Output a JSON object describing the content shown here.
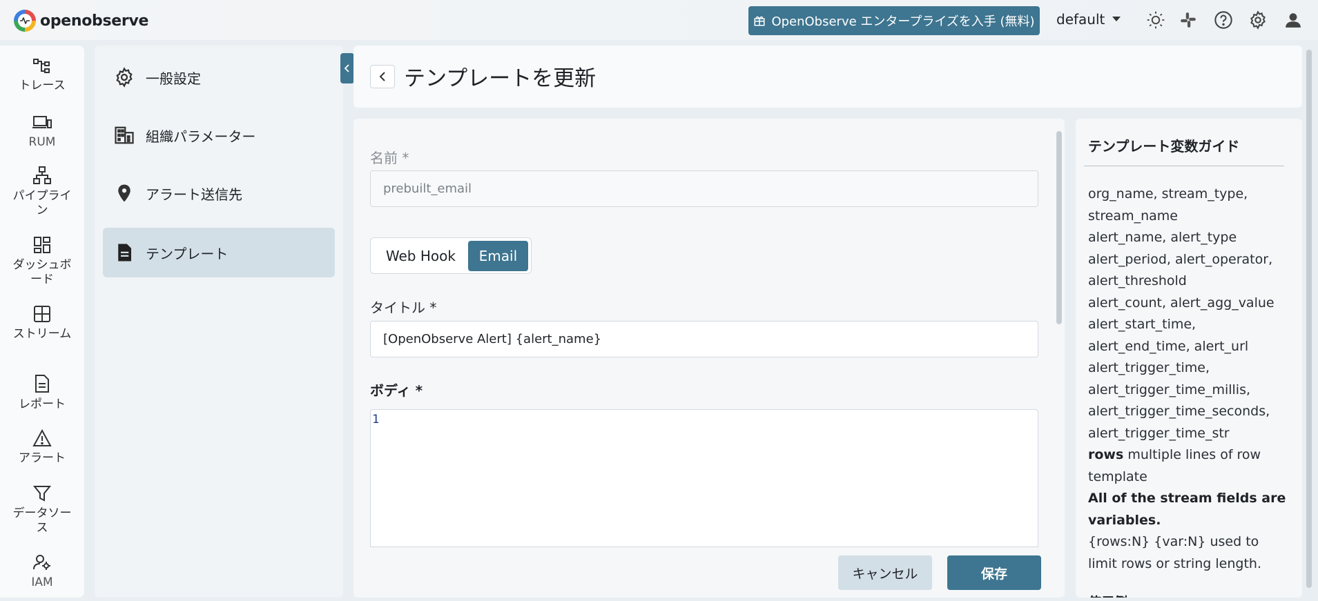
{
  "topbar": {
    "logo_text": "openobserve",
    "enterprise_label": "OpenObserve エンタープライズを入手 (無料)",
    "org_value": "default",
    "icons": [
      "theme-icon",
      "slack-icon",
      "help-icon",
      "settings-icon",
      "user-icon"
    ]
  },
  "leftnav": {
    "items": [
      {
        "label": "トレース",
        "icon": "traces-icon"
      },
      {
        "label": "RUM",
        "icon": "rum-icon"
      },
      {
        "label": "パイプライン",
        "icon": "pipeline-icon"
      },
      {
        "label": "ダッシュボード",
        "icon": "dashboard-icon"
      },
      {
        "label": "ストリーム",
        "icon": "streams-icon"
      },
      {
        "label": "レポート",
        "icon": "reports-icon"
      },
      {
        "label": "アラート",
        "icon": "alerts-icon"
      },
      {
        "label": "データソース",
        "icon": "datasources-icon"
      },
      {
        "label": "IAM",
        "icon": "iam-icon"
      }
    ]
  },
  "subnav": {
    "items": [
      {
        "label": "一般設定",
        "icon": "gear-icon"
      },
      {
        "label": "組織パラメーター",
        "icon": "building-icon"
      },
      {
        "label": "アラート送信先",
        "icon": "location-pin-icon"
      },
      {
        "label": "テンプレート",
        "icon": "document-icon",
        "active": true
      }
    ]
  },
  "header": {
    "title": "テンプレートを更新"
  },
  "form": {
    "name_label": "名前 *",
    "name_value": "prebuilt_email",
    "type_options": [
      "Web Hook",
      "Email"
    ],
    "type_selected": "Email",
    "title_label": "タイトル *",
    "title_value": "[OpenObserve Alert] {alert_name}",
    "body_label": "ボディ *",
    "body_line_number": "1",
    "cancel_label": "キャンセル",
    "save_label": "保存"
  },
  "guide": {
    "title": "テンプレート変数ガイド",
    "vars_1": "org_name, stream_type, stream_name",
    "vars_2": "alert_name, alert_type",
    "vars_3": "alert_period, alert_operator, alert_threshold",
    "vars_4": "alert_count, alert_agg_value",
    "vars_5": "alert_start_time, alert_end_time, alert_url",
    "vars_6": "alert_trigger_time, alert_trigger_time_millis, alert_trigger_time_seconds, alert_trigger_time_str",
    "rows_keyword": "rows",
    "rows_desc": " multiple lines of row template",
    "stream_fields_note": "All of the stream fields are variables.",
    "limit_note": "{rows:N} {var:N} used to limit rows or string length.",
    "example_heading": "使用例"
  },
  "colors": {
    "primary": "#3e7590",
    "active_bg": "#d3dfe6"
  }
}
